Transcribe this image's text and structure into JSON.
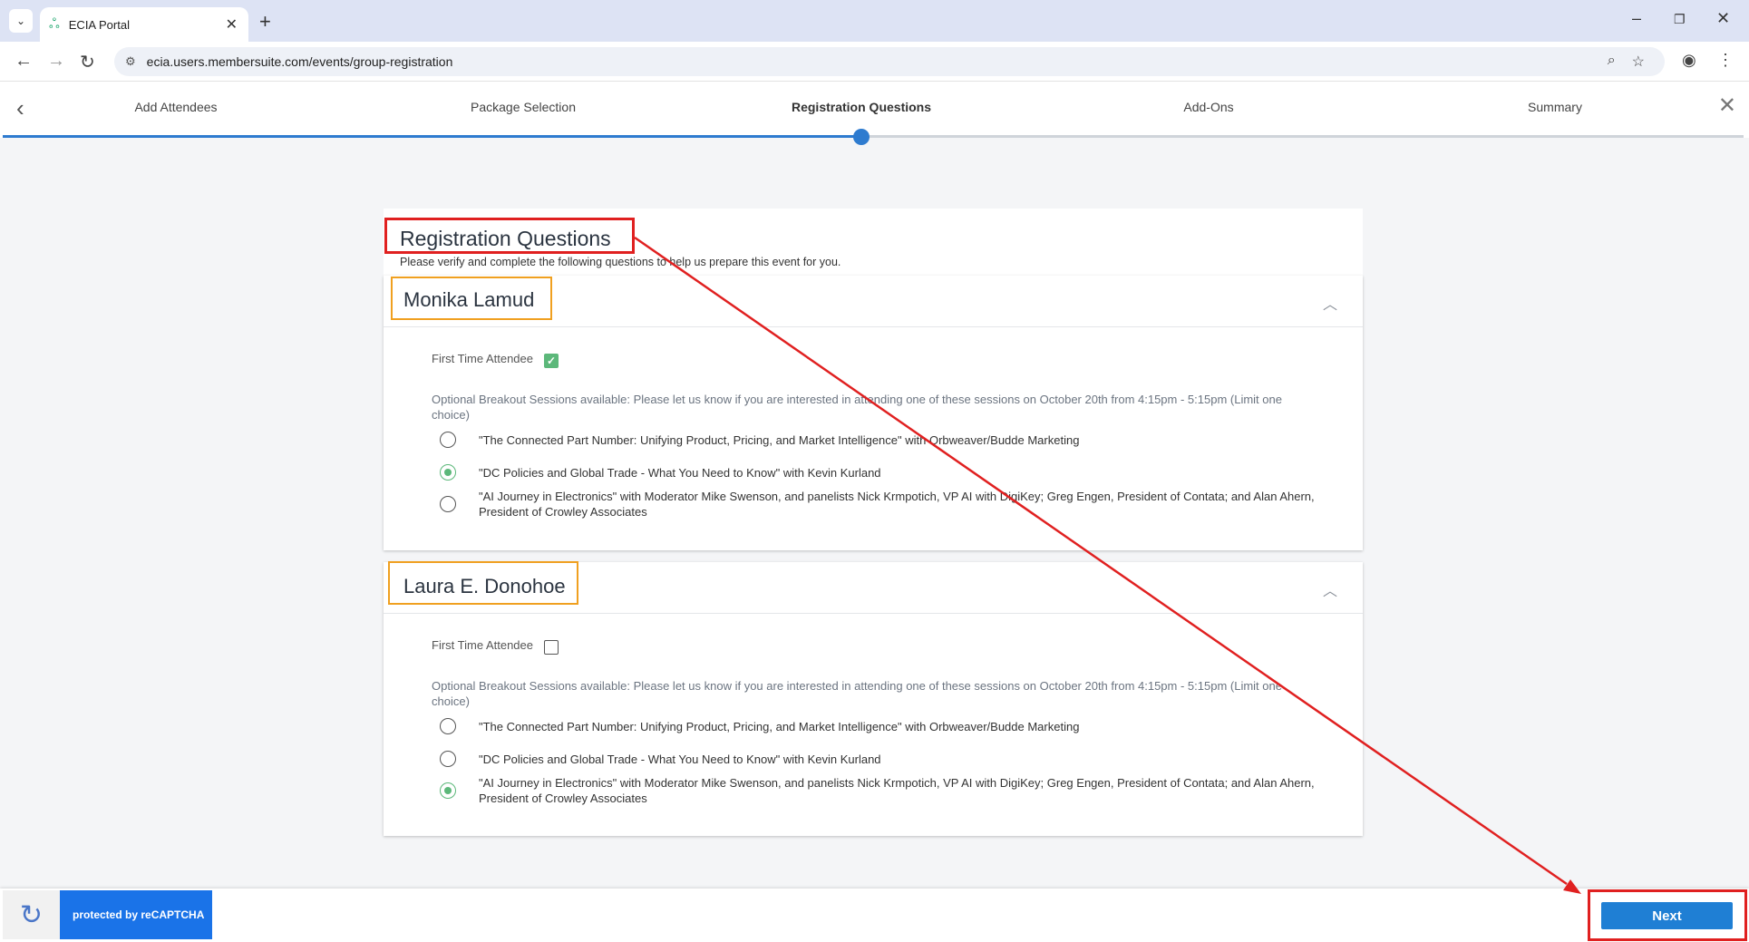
{
  "browser": {
    "tab_title": "ECIA Portal",
    "url": "ecia.users.membersuite.com/events/group-registration"
  },
  "stepper": {
    "steps": [
      "Add Attendees",
      "Package Selection",
      "Registration Questions",
      "Add-Ons",
      "Summary"
    ],
    "active_step": "Registration Questions"
  },
  "page": {
    "title": "Registration Questions",
    "subtitle": "Please verify and complete the following questions to help us prepare this event for you."
  },
  "attendees": [
    {
      "name": "Monika Lamud",
      "first_time_label": "First Time Attendee",
      "first_time_checked": true,
      "question": "Optional Breakout Sessions available: Please let us know if you are interested in attending one of these sessions on October 20th from 4:15pm - 5:15pm (Limit one choice)",
      "options": [
        "\"The Connected Part Number: Unifying Product, Pricing, and Market Intelligence\" with Orbweaver/Budde Marketing",
        "\"DC Policies and Global Trade - What You Need to Know\" with Kevin Kurland",
        "\"AI Journey in Electronics\" with Moderator Mike Swenson, and panelists Nick Krmpotich, VP AI with DigiKey; Greg Engen, President of Contata; and Alan Ahern, President of Crowley Associates"
      ],
      "selected_option": 1
    },
    {
      "name": "Laura E. Donohoe",
      "first_time_label": "First Time Attendee",
      "first_time_checked": false,
      "question": "Optional Breakout Sessions available: Please let us know if you are interested in attending one of these sessions on October 20th from 4:15pm - 5:15pm (Limit one choice)",
      "options": [
        "\"The Connected Part Number: Unifying Product, Pricing, and Market Intelligence\" with Orbweaver/Budde Marketing",
        "\"DC Policies and Global Trade - What You Need to Know\" with Kevin Kurland",
        "\"AI Journey in Electronics\" with Moderator Mike Swenson, and panelists Nick Krmpotich, VP AI with DigiKey; Greg Engen, President of Contata; and Alan Ahern, President of Crowley Associates"
      ],
      "selected_option": 2
    }
  ],
  "footer": {
    "recaptcha_text": "protected by reCAPTCHA",
    "next_label": "Next"
  },
  "colors": {
    "accent": "#2e7bcf",
    "button": "#1f7fd4",
    "radio_selected": "#5cb87a",
    "annotation_red": "#e02020",
    "annotation_orange": "#f0a020"
  }
}
